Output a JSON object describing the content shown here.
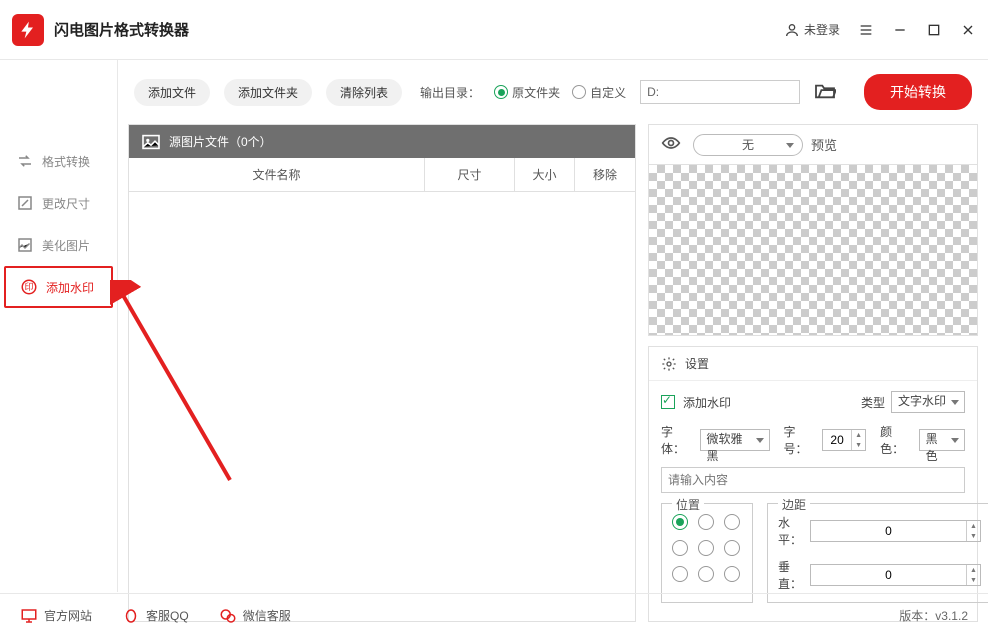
{
  "app_title": "闪电图片格式转换器",
  "login_label": "未登录",
  "sidebar": [
    {
      "label": "格式转换"
    },
    {
      "label": "更改尺寸"
    },
    {
      "label": "美化图片"
    },
    {
      "label": "添加水印"
    }
  ],
  "toolbar": {
    "add_file": "添加文件",
    "add_folder": "添加文件夹",
    "clear_list": "清除列表",
    "out_label": "输出目录：",
    "radio_src": "原文件夹",
    "radio_custom": "自定义",
    "out_path": "D:",
    "start": "开始转换"
  },
  "file_panel": {
    "header": "源图片文件（0个）",
    "col_name": "文件名称",
    "col_dim": "尺寸",
    "col_size": "大小",
    "col_del": "移除"
  },
  "preview": {
    "select": "无",
    "label": "预览"
  },
  "settings": {
    "title": "设置",
    "add_wm": "添加水印",
    "type_label": "类型",
    "type_value": "文字水印",
    "font_label": "字体：",
    "font_value": "微软雅黑",
    "size_label": "字号：",
    "size_value": "20",
    "color_label": "颜色：",
    "color_value": "黑色",
    "wm_placeholder": "请输入内容",
    "pos_legend": "位置",
    "margin_legend": "边距",
    "h_label": "水平：",
    "h_value": "0",
    "v_label": "垂直：",
    "v_value": "0"
  },
  "footer": {
    "site": "官方网站",
    "qq": "客服QQ",
    "wechat": "微信客服",
    "version": "版本：v3.1.2"
  }
}
